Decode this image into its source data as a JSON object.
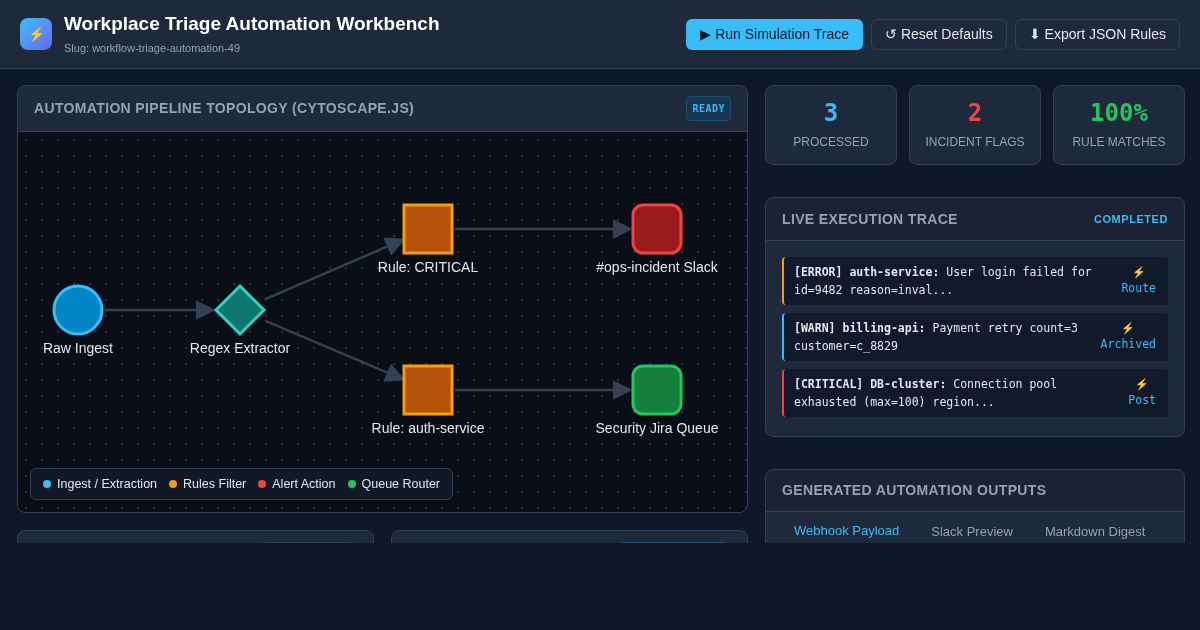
{
  "header": {
    "icon": "⚡",
    "title": "Workplace Triage Automation Workbench",
    "slug": "Slug: workflow-triage-automation-49",
    "buttons": [
      {
        "label": "▶ Run Simulation Trace",
        "kind": "primary"
      },
      {
        "label": "↺ Reset Defaults",
        "kind": "secondary"
      },
      {
        "label": "⬇ Export JSON Rules",
        "kind": "secondary"
      }
    ]
  },
  "topology": {
    "title": "AUTOMATION PIPELINE TOPOLOGY (CYTOSCAPE.JS)",
    "badge": "READY",
    "nodes": [
      {
        "label": "Raw Ingest",
        "kind": "ingest"
      },
      {
        "label": "Regex Extractor",
        "kind": "extractor"
      },
      {
        "label": "Rule: CRITICAL",
        "kind": "rule"
      },
      {
        "label": "#ops-incident Slack",
        "kind": "alert"
      },
      {
        "label": "Rule: auth-service",
        "kind": "rule"
      },
      {
        "label": "Security Jira Queue",
        "kind": "queue"
      }
    ],
    "legend": [
      {
        "label": "Ingest / Extraction",
        "color": "#38bdf8"
      },
      {
        "label": "Rules Filter",
        "color": "#f59e0b"
      },
      {
        "label": "Alert Action",
        "color": "#ef4444"
      },
      {
        "label": "Queue Router",
        "color": "#22c55e"
      }
    ]
  },
  "stats": [
    {
      "value": "3",
      "label": "PROCESSED",
      "color": "#38bdf8"
    },
    {
      "value": "2",
      "label": "INCIDENT FLAGS",
      "color": "#ef4444"
    },
    {
      "value": "100%",
      "label": "RULE MATCHES",
      "color": "#22c55e"
    }
  ],
  "trace": {
    "title": "LIVE EXECUTION TRACE",
    "status": "COMPLETED",
    "entries": [
      {
        "head": "[ERROR] auth-service:",
        "message": " User login failed for id=9482 reason=inval...",
        "icon": "⚡",
        "action": "Route",
        "color": "#f59e0b"
      },
      {
        "head": "[WARN] billing-api:",
        "message": " Payment retry count=3 customer=c_8829",
        "icon": "⚡",
        "action": "Archived",
        "color": "#38bdf8"
      },
      {
        "head": "[CRITICAL] DB-cluster:",
        "message": " Connection pool exhausted (max=100) region...",
        "icon": "⚡",
        "action": "Post",
        "color": "#ef4444"
      }
    ]
  },
  "outputs": {
    "title": "GENERATED AUTOMATION OUTPUTS",
    "tabs": [
      {
        "label": "Webhook Payload",
        "selected": true
      },
      {
        "label": "Slack Preview",
        "selected": false
      },
      {
        "label": "Markdown Digest",
        "selected": false
      }
    ]
  }
}
